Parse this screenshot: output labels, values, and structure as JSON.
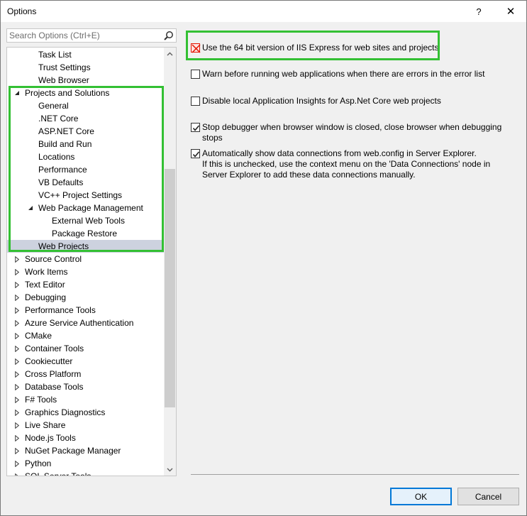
{
  "window": {
    "title": "Options",
    "help_label": "?",
    "close_label": "✕"
  },
  "search": {
    "placeholder": "Search Options (Ctrl+E)",
    "value": ""
  },
  "tree": {
    "items": [
      {
        "label": "Task List",
        "level": 2,
        "expander": "none"
      },
      {
        "label": "Trust Settings",
        "level": 2,
        "expander": "none"
      },
      {
        "label": "Web Browser",
        "level": 2,
        "expander": "none"
      },
      {
        "label": "Projects and Solutions",
        "level": 1,
        "expander": "expanded"
      },
      {
        "label": "General",
        "level": 2,
        "expander": "none"
      },
      {
        "label": ".NET Core",
        "level": 2,
        "expander": "none"
      },
      {
        "label": "ASP.NET Core",
        "level": 2,
        "expander": "none"
      },
      {
        "label": "Build and Run",
        "level": 2,
        "expander": "none"
      },
      {
        "label": "Locations",
        "level": 2,
        "expander": "none"
      },
      {
        "label": "Performance",
        "level": 2,
        "expander": "none"
      },
      {
        "label": "VB Defaults",
        "level": 2,
        "expander": "none"
      },
      {
        "label": "VC++ Project Settings",
        "level": 2,
        "expander": "none"
      },
      {
        "label": "Web Package Management",
        "level": 2,
        "expander": "expanded"
      },
      {
        "label": "External Web Tools",
        "level": 3,
        "expander": "none"
      },
      {
        "label": "Package Restore",
        "level": 3,
        "expander": "none"
      },
      {
        "label": "Web Projects",
        "level": 2,
        "expander": "none",
        "selected": true
      },
      {
        "label": "Source Control",
        "level": 1,
        "expander": "collapsed"
      },
      {
        "label": "Work Items",
        "level": 1,
        "expander": "collapsed"
      },
      {
        "label": "Text Editor",
        "level": 1,
        "expander": "collapsed"
      },
      {
        "label": "Debugging",
        "level": 1,
        "expander": "collapsed"
      },
      {
        "label": "Performance Tools",
        "level": 1,
        "expander": "collapsed"
      },
      {
        "label": "Azure Service Authentication",
        "level": 1,
        "expander": "collapsed"
      },
      {
        "label": "CMake",
        "level": 1,
        "expander": "collapsed"
      },
      {
        "label": "Container Tools",
        "level": 1,
        "expander": "collapsed"
      },
      {
        "label": "Cookiecutter",
        "level": 1,
        "expander": "collapsed"
      },
      {
        "label": "Cross Platform",
        "level": 1,
        "expander": "collapsed"
      },
      {
        "label": "Database Tools",
        "level": 1,
        "expander": "collapsed"
      },
      {
        "label": "F# Tools",
        "level": 1,
        "expander": "collapsed"
      },
      {
        "label": "Graphics Diagnostics",
        "level": 1,
        "expander": "collapsed"
      },
      {
        "label": "Live Share",
        "level": 1,
        "expander": "collapsed"
      },
      {
        "label": "Node.js Tools",
        "level": 1,
        "expander": "collapsed"
      },
      {
        "label": "NuGet Package Manager",
        "level": 1,
        "expander": "collapsed"
      },
      {
        "label": "Python",
        "level": 1,
        "expander": "collapsed"
      },
      {
        "label": "SQL Server Tools",
        "level": 1,
        "expander": "collapsed"
      }
    ]
  },
  "options": [
    {
      "label": "Use the 64 bit version of IIS Express for web sites and projects",
      "checked": false,
      "error": true
    },
    {
      "label": "Warn before running web applications when there are errors in the error list",
      "checked": false
    },
    {
      "label": "Disable local Application Insights for Asp.Net Core web projects",
      "checked": false
    },
    {
      "label": "Stop debugger when browser window is closed, close browser when debugging stops",
      "checked": true
    },
    {
      "label": "Automatically show data connections from web.config in Server Explorer.",
      "note": "If this is unchecked, use the context menu on the 'Data Connections' node in Server Explorer to add these data connections manually.",
      "checked": true
    }
  ],
  "buttons": {
    "ok_label": "OK",
    "cancel_label": "Cancel"
  },
  "colors": {
    "highlight_border": "#33c033",
    "selection": "#cdd2df",
    "error": "#e51400",
    "accent": "#0078d7"
  },
  "icons": {
    "search": "search-icon",
    "scroll_up": "chevron-up-icon",
    "scroll_down": "chevron-down-icon"
  }
}
